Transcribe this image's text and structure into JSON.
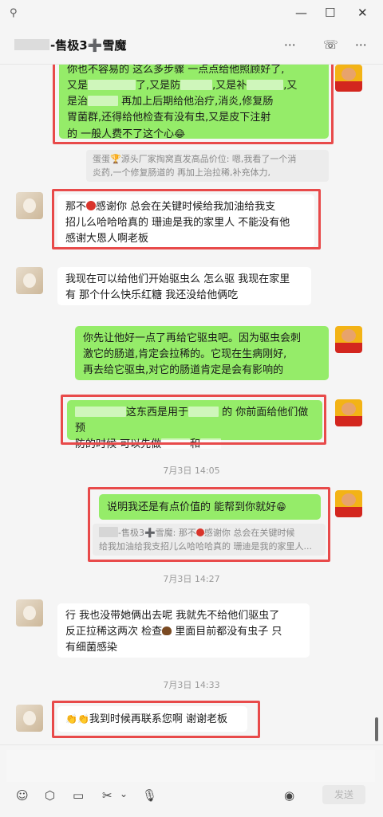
{
  "window": {
    "pin_icon": "⚲",
    "minimize": "—",
    "maximize": "☐",
    "close": "✕"
  },
  "header": {
    "chat_name": "-售极3➕雪魔",
    "more_icon": "⋯",
    "call_icon": "☏",
    "menu_icon": "⋯"
  },
  "messages": {
    "m1": {
      "line1": "你也不容易的 这么多步骤 一点点给他照顾好了,",
      "line2a": "又是",
      "line2b": "了,又是防",
      "line2c": ",又是补",
      "line2d": ",又",
      "line3a": "是治",
      "line3b": " 再加上后期给他治疗,消炎,修复肠",
      "line4": "胃菌群,还得给他检查有没有虫,又是皮下注射",
      "line5": "的    一般人费不了这个心",
      "emoji": "😂"
    },
    "q1": {
      "line1": "蛋蛋🏆源头厂家掏窝直发高品价位: 嗯,我看了一个消",
      "line2": "炎药,一个修复肠道的 再加上治拉稀,补充体力,"
    },
    "m2": {
      "line1a": "那不",
      "line1b": "感谢你 总会在关键时候给我加油给我支",
      "line2": "招儿么哈哈哈真的 珊迪是我的家里人 不能没有他",
      "line3": "感谢大恩人啊老板"
    },
    "m3": {
      "line1": "我现在可以给他们开始驱虫么 怎么驱 我现在家里",
      "line2": "有 那个什么快乐红糖 我还没给他俩吃"
    },
    "m4": {
      "line1": "你先让他好一点了再给它驱虫吧。因为驱虫会刺",
      "line2": "激它的肠道,肯定会拉稀的。它现在生病刚好,",
      "line3": "再去给它驱虫,对它的肠道肯定是会有影响的"
    },
    "m5": {
      "line1a": "这东西是用于",
      "line1b": " 的  你前面给他们做预",
      "line2a": "防的时候 可以先做",
      "line2b": "和"
    },
    "t1": "7月3日 14:05",
    "m6": {
      "text": "说明我还是有点价值的  能帮到你就好",
      "emoji": "😁"
    },
    "q2": {
      "line1": "-售极3➕雪魔: 那不",
      "line1b": "感谢你 总会在关键时候",
      "line2": "给我加油给我支招儿么哈哈哈真的 珊迪是我的家里人..."
    },
    "t2": "7月3日 14:27",
    "m7": {
      "line1": "行 我也没带她俩出去呢 我就先不给他们驱虫了",
      "line2a": "反正拉稀这两次 检查",
      "line2b": " 里面目前都没有虫子 只",
      "line3": "有细菌感染"
    },
    "t3": "7月3日 14:33",
    "m8": {
      "emoji": "👏👏",
      "text": "我到时候再联系您啊 谢谢老板"
    }
  },
  "inputbar": {
    "emoji_icon": "☺",
    "box_icon": "⬡",
    "folder_icon": "▭",
    "scissors_icon": "✂",
    "chevron": "⌄",
    "mic_icon": "🎙",
    "voice_icon": "◉",
    "send_label": "发送"
  }
}
